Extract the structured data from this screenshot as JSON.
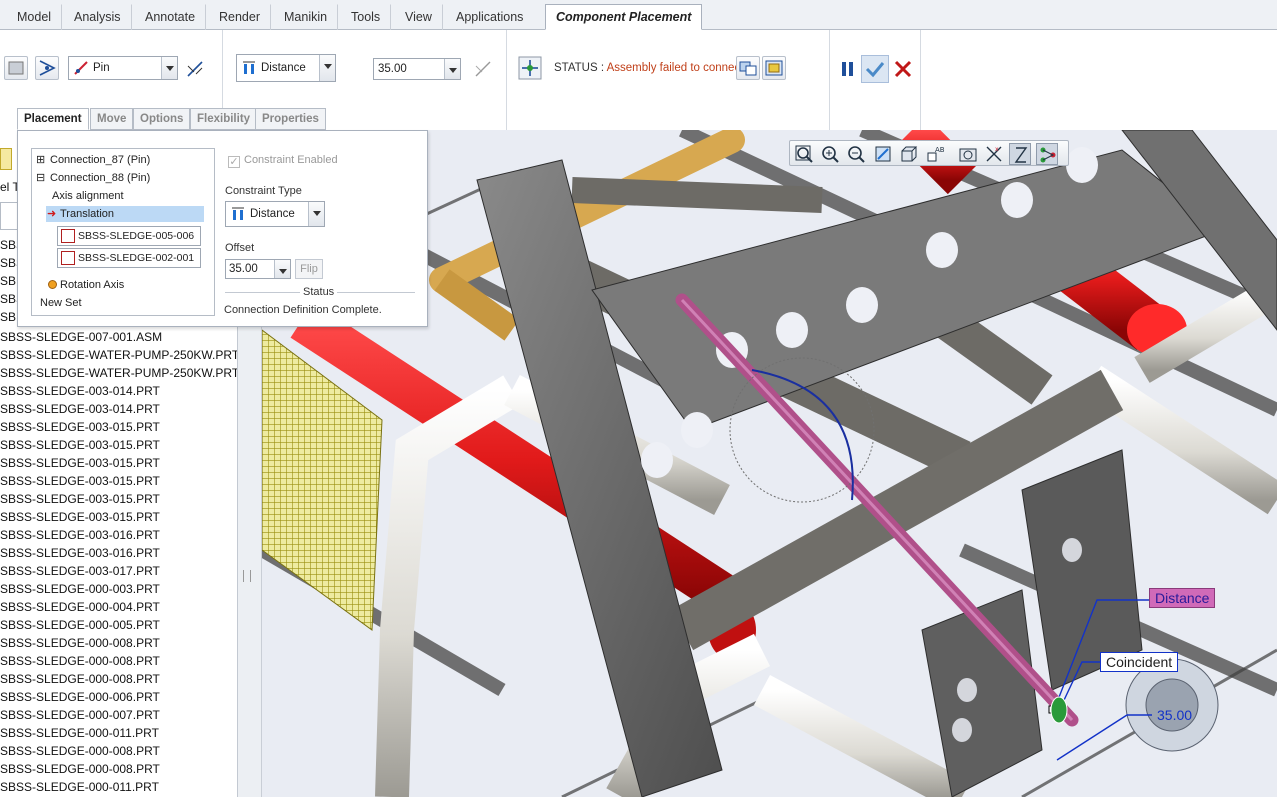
{
  "main_tabs": [
    {
      "label": "Model"
    },
    {
      "label": "Analysis"
    },
    {
      "label": "Annotate"
    },
    {
      "label": "Render"
    },
    {
      "label": "Manikin"
    },
    {
      "label": "Tools"
    },
    {
      "label": "View"
    },
    {
      "label": "Applications"
    },
    {
      "label": "Component Placement"
    }
  ],
  "ribbon": {
    "connection_type": "Pin",
    "constraint_type": "Distance",
    "offset_value": "35.00",
    "status_label": "STATUS : ",
    "status_value": "Assembly failed to connect"
  },
  "sub_tabs": [
    {
      "label": "Placement"
    },
    {
      "label": "Move"
    },
    {
      "label": "Options"
    },
    {
      "label": "Flexibility"
    },
    {
      "label": "Properties"
    }
  ],
  "placement": {
    "connection_87": "Connection_87 (Pin)",
    "connection_88": "Connection_88 (Pin)",
    "axis_alignment": "Axis alignment",
    "translation": "Translation",
    "ref_1": "SBSS-SLEDGE-005-006",
    "ref_2": "SBSS-SLEDGE-002-001",
    "rotation_axis": "Rotation Axis",
    "new_set": "New Set",
    "constraint_enabled": "Constraint Enabled",
    "constraint_type_label": "Constraint Type",
    "constraint_type_value": "Distance",
    "offset_label": "Offset",
    "offset_value": "35.00",
    "flip_label": "Flip",
    "status_title": "Status",
    "status_text": "Connection Definition Complete."
  },
  "tree": {
    "partial_rows": [
      "SBSS",
      "SBS",
      "SB",
      "SBS",
      "SB"
    ],
    "header_partial": "el T",
    "items": [
      "SBSS-SLEDGE-007-001.ASM",
      "SBSS-SLEDGE-WATER-PUMP-250KW.PRT",
      "SBSS-SLEDGE-WATER-PUMP-250KW.PRT",
      "SBSS-SLEDGE-003-014.PRT",
      "SBSS-SLEDGE-003-014.PRT",
      "SBSS-SLEDGE-003-015.PRT",
      "SBSS-SLEDGE-003-015.PRT",
      "SBSS-SLEDGE-003-015.PRT",
      "SBSS-SLEDGE-003-015.PRT",
      "SBSS-SLEDGE-003-015.PRT",
      "SBSS-SLEDGE-003-015.PRT",
      "SBSS-SLEDGE-003-016.PRT",
      "SBSS-SLEDGE-003-016.PRT",
      "SBSS-SLEDGE-003-017.PRT",
      "SBSS-SLEDGE-000-003.PRT",
      "SBSS-SLEDGE-000-004.PRT",
      "SBSS-SLEDGE-000-005.PRT",
      "SBSS-SLEDGE-000-008.PRT",
      "SBSS-SLEDGE-000-008.PRT",
      "SBSS-SLEDGE-000-008.PRT",
      "SBSS-SLEDGE-000-006.PRT",
      "SBSS-SLEDGE-000-007.PRT",
      "SBSS-SLEDGE-000-011.PRT",
      "SBSS-SLEDGE-000-008.PRT",
      "SBSS-SLEDGE-000-008.PRT",
      "SBSS-SLEDGE-000-011.PRT"
    ]
  },
  "viewport": {
    "tag_distance": "Distance",
    "tag_coincident": "Coincident",
    "tag_value": "35.00"
  },
  "colors": {
    "accent": "#1f6fd0",
    "status_error": "#c0401a",
    "frame_grey": "#6b6b6b",
    "cylinder_red": "#e11a1a",
    "pipe_white": "#e6e4de",
    "pin_magenta": "#b0508a",
    "mesh_yellow": "#e8e230"
  }
}
